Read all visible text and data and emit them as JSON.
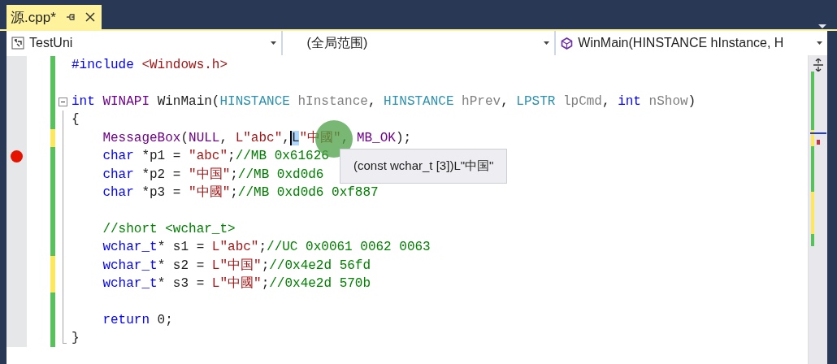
{
  "tab": {
    "title": "源.cpp*",
    "selected": true
  },
  "navigation_bar": {
    "project": "TestUni",
    "scope": "(全局范围)",
    "member": "WinMain(HINSTANCE hInstance, H"
  },
  "editor": {
    "lines": [
      {
        "modified": false,
        "breakpoint": false,
        "tokens": [
          {
            "kind": "keyword",
            "text": "#include"
          },
          {
            "kind": "string",
            "text": " <Windows.h>"
          }
        ]
      },
      {
        "modified": false,
        "breakpoint": false
      },
      {
        "modified": false,
        "breakpoint": false,
        "tokens": [
          {
            "kind": "keyword",
            "text": "int"
          },
          {
            "kind": "macro",
            "text": " WINAPI"
          },
          {
            "kind": "plain",
            "text": " WinMain("
          },
          {
            "kind": "type",
            "text": "HINSTANCE"
          },
          {
            "kind": "param",
            "text": " hInstance"
          },
          {
            "kind": "plain",
            "text": ","
          },
          {
            "kind": "type",
            "text": " HINSTANCE"
          },
          {
            "kind": "param",
            "text": " hPrev"
          },
          {
            "kind": "plain",
            "text": ","
          },
          {
            "kind": "type",
            "text": " LPSTR"
          },
          {
            "kind": "param",
            "text": " lpCmd"
          },
          {
            "kind": "plain",
            "text": ","
          },
          {
            "kind": "keyword",
            "text": " int"
          },
          {
            "kind": "param",
            "text": " nShow"
          },
          {
            "kind": "plain",
            "text": ")"
          }
        ],
        "children": [
          {
            "modified": false,
            "breakpoint": false,
            "tokens": [
              {
                "kind": "plain",
                "text": "{"
              }
            ]
          },
          {
            "modified": true,
            "breakpoint": false,
            "tokens": [
              {
                "kind": "macro",
                "text": "    MessageBox"
              },
              {
                "kind": "plain",
                "text": "("
              },
              {
                "kind": "macro",
                "text": "NULL"
              },
              {
                "kind": "plain",
                "text": ","
              },
              {
                "kind": "string",
                "text": " L\"abc\""
              },
              {
                "kind": "plain",
                "text": ","
              },
              {
                "kind": "selection",
                "text": "L"
              },
              {
                "kind": "string",
                "text": "\"中國\""
              },
              {
                "kind": "plain",
                "text": ","
              },
              {
                "kind": "macro",
                "text": " MB_OK"
              },
              {
                "kind": "plain",
                "text": ");"
              }
            ]
          },
          {
            "modified": false,
            "breakpoint": true,
            "tokens": [
              {
                "kind": "keyword",
                "text": "    char"
              },
              {
                "kind": "plain",
                "text": " *p1 ="
              },
              {
                "kind": "string",
                "text": " \"abc\""
              },
              {
                "kind": "plain",
                "text": ";"
              },
              {
                "kind": "comment",
                "text": "//MB 0x61626"
              }
            ]
          },
          {
            "modified": false,
            "breakpoint": false,
            "tokens": [
              {
                "kind": "keyword",
                "text": "    char"
              },
              {
                "kind": "plain",
                "text": " *p2 ="
              },
              {
                "kind": "string",
                "text": " \"中国\""
              },
              {
                "kind": "plain",
                "text": ";"
              },
              {
                "kind": "comment",
                "text": "//MB 0xd0d6"
              }
            ]
          },
          {
            "modified": false,
            "breakpoint": false,
            "tokens": [
              {
                "kind": "keyword",
                "text": "    char"
              },
              {
                "kind": "plain",
                "text": " *p3 ="
              },
              {
                "kind": "string",
                "text": " \"中國\""
              },
              {
                "kind": "plain",
                "text": ";"
              },
              {
                "kind": "comment",
                "text": "//MB 0xd0d6 0xf887"
              }
            ]
          },
          {
            "modified": false,
            "breakpoint": false
          },
          {
            "modified": false,
            "breakpoint": false,
            "tokens": [
              {
                "kind": "comment",
                "text": "    //short <wchar_t>"
              }
            ]
          },
          {
            "modified": false,
            "breakpoint": false,
            "tokens": [
              {
                "kind": "keyword",
                "text": "    wchar_t"
              },
              {
                "kind": "plain",
                "text": "* s1 ="
              },
              {
                "kind": "string",
                "text": " L\"abc\""
              },
              {
                "kind": "plain",
                "text": ";"
              },
              {
                "kind": "comment",
                "text": "//UC 0x0061 0062 0063"
              }
            ]
          },
          {
            "modified": true,
            "breakpoint": false,
            "tokens": [
              {
                "kind": "keyword",
                "text": "    wchar_t"
              },
              {
                "kind": "plain",
                "text": "* s2 ="
              },
              {
                "kind": "string",
                "text": " L\"中国\""
              },
              {
                "kind": "plain",
                "text": ";"
              },
              {
                "kind": "comment",
                "text": "//0x4e2d 56fd"
              }
            ]
          },
          {
            "modified": true,
            "breakpoint": false,
            "tokens": [
              {
                "kind": "keyword",
                "text": "    wchar_t"
              },
              {
                "kind": "plain",
                "text": "* s3 ="
              },
              {
                "kind": "string",
                "text": " L\"中國\""
              },
              {
                "kind": "plain",
                "text": ";"
              },
              {
                "kind": "comment",
                "text": "//0x4e2d 570b"
              }
            ]
          },
          {
            "modified": false,
            "breakpoint": false
          },
          {
            "modified": false,
            "breakpoint": false,
            "tokens": [
              {
                "kind": "keyword",
                "text": "    return"
              },
              {
                "kind": "plain",
                "text": " 0;"
              }
            ]
          },
          {
            "modified": false,
            "breakpoint": false,
            "tokens": [
              {
                "kind": "plain",
                "text": "}"
              }
            ]
          }
        ]
      }
    ]
  },
  "tooltip": {
    "text": "(const wchar_t [3])L\"中国\""
  }
}
